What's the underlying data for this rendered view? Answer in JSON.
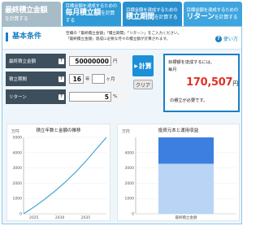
{
  "tabs": [
    {
      "small": "",
      "big": "最終積立金額",
      "tail": "を計算する"
    },
    {
      "small": "目標金額を達成するための",
      "big": "毎月積立額",
      "tail": "を計算する"
    },
    {
      "small": "目標金額を達成するための",
      "big": "積立期間",
      "tail": "を計算する"
    },
    {
      "small": "目標金額を達成するための",
      "big": "リターン",
      "tail": "を計算する"
    }
  ],
  "panel": {
    "title": "基本条件",
    "desc_lines": [
      "空欄の「最終積立金額」「積立期間」「リターン」をご入力ください。",
      "「最終積立金額」達成に必要な月々の積立額が計算されます。"
    ],
    "help_label": "使い方",
    "help_icon": "question-icon"
  },
  "form": {
    "final_label": "最終積立金額",
    "final_value": "50000000",
    "final_unit": "円",
    "period_label": "積立期間",
    "period_years": "16",
    "period_years_unit": "年",
    "period_months": "",
    "period_months_unit": "ヶ月",
    "return_label": "リターン",
    "return_value": "5",
    "return_unit": "%",
    "help_mark": "?"
  },
  "buttons": {
    "calc_label": "計算",
    "calc_icon": "arrow-right-icon",
    "clear_label": "クリア"
  },
  "result": {
    "line1": "目標額を達成するには、",
    "line2": "毎月",
    "amount": "170,507",
    "amount_unit": "円",
    "line3": "の積立が必要です。"
  },
  "chart_data": [
    {
      "type": "line",
      "title": "積立年数と金額の推移",
      "unit": "万円",
      "x": [
        2023,
        2025,
        2027,
        2029,
        2031,
        2033,
        2035,
        2037,
        2039
      ],
      "values": [
        0,
        440,
        930,
        1470,
        2060,
        2710,
        3430,
        4220,
        5000
      ],
      "xtick_labels": [
        "2025",
        "2030",
        "2035"
      ],
      "xticks": [
        2025,
        2030,
        2035
      ],
      "ytick_labels": [
        "5000",
        "4000",
        "3000",
        "2000",
        "1000",
        "0"
      ],
      "ylim": [
        0,
        5000
      ],
      "color": "#4aa4d8"
    },
    {
      "type": "bar",
      "title": "投資元本と運用収益",
      "unit": "万円",
      "categories": [
        "最終積立金額"
      ],
      "series": [
        {
          "name": "",
          "values": [
            3274
          ],
          "color": "#b9d4f5"
        },
        {
          "name": "",
          "values": [
            1726
          ],
          "color": "#3c7fe0"
        }
      ],
      "ytick_labels": [
        "4000",
        "3000",
        "2000",
        "1000",
        "0"
      ],
      "ylim": [
        0,
        5000
      ]
    }
  ]
}
